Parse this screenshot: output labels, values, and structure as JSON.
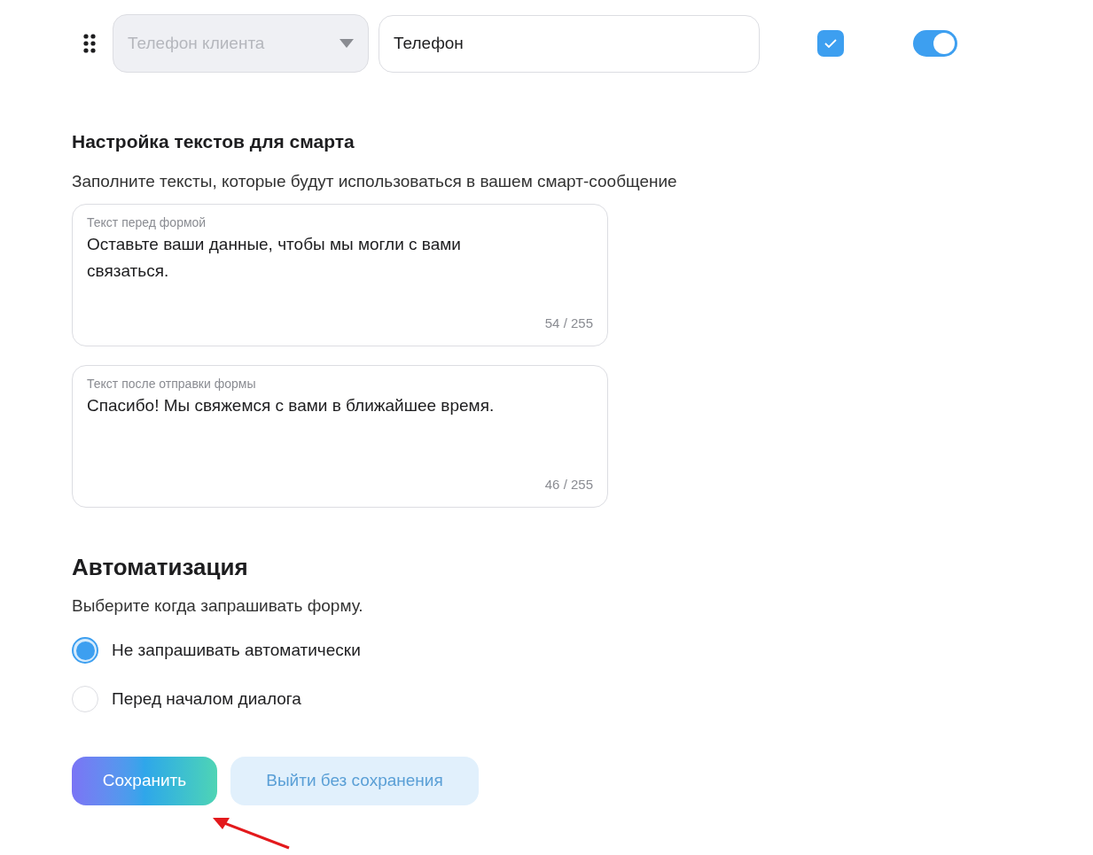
{
  "field_row": {
    "select": {
      "placeholder": "Телефон клиента",
      "disabled": true
    },
    "label_input": {
      "value": "Телефон"
    },
    "required": {
      "checked": true
    },
    "visible": {
      "on": true
    }
  },
  "texts_section": {
    "title": "Настройка текстов для смарта",
    "description": "Заполните тексты, которые будут использоваться в вашем смарт-сообщение",
    "fields": [
      {
        "label": "Текст перед формой",
        "value": "Оставьте ваши данные, чтобы мы могли с вами связаться.",
        "counter": "54 / 255"
      },
      {
        "label": "Текст после отправки формы",
        "value": "Спасибо! Мы свяжемся с вами в ближайшее время.",
        "counter": "46 / 255"
      }
    ]
  },
  "automation": {
    "title": "Автоматизация",
    "description": "Выберите когда запрашивать форму.",
    "options": [
      {
        "label": "Не запрашивать автоматически",
        "selected": true
      },
      {
        "label": "Перед началом диалога",
        "selected": false
      }
    ]
  },
  "buttons": [
    {
      "kind": "primary",
      "label": "Сохранить"
    },
    {
      "kind": "secondary",
      "label": "Выйти без сохранения"
    }
  ]
}
